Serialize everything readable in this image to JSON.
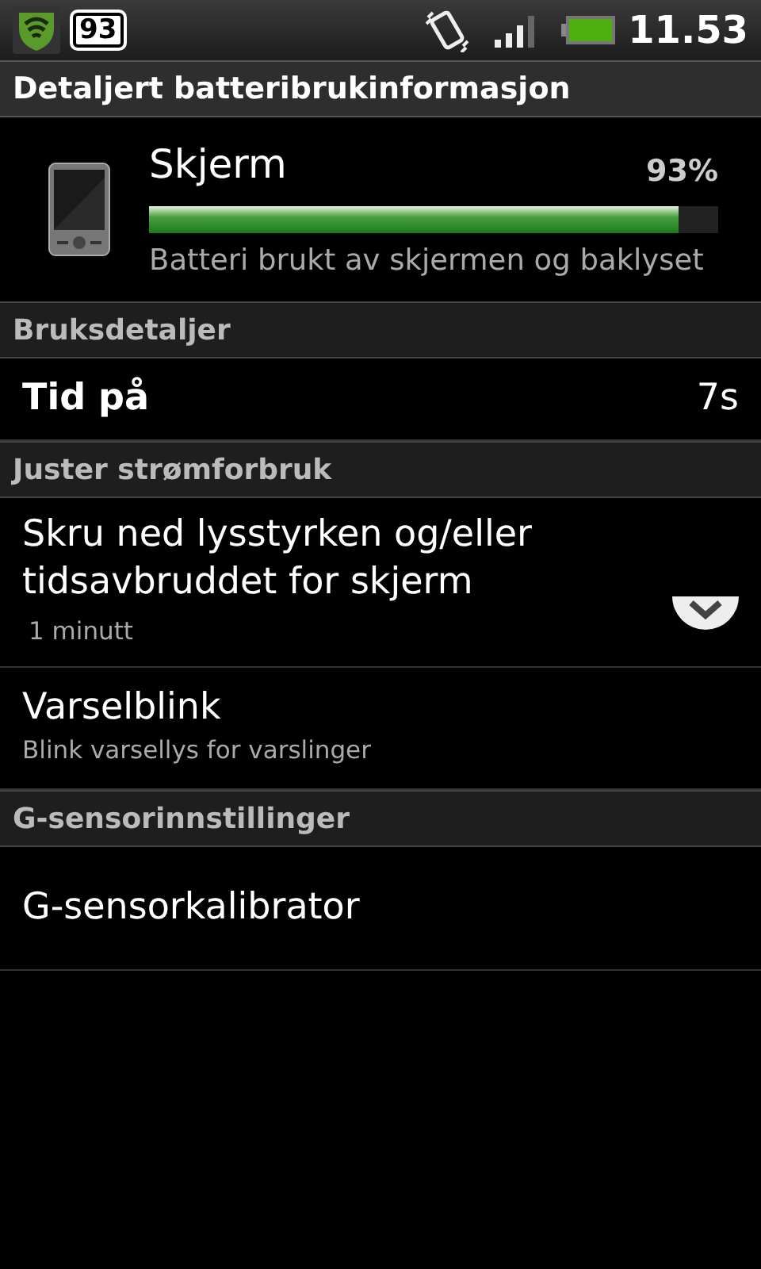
{
  "status_bar": {
    "badge": "93",
    "time": "11.53"
  },
  "title": "Detaljert batteribrukinformasjon",
  "usage": {
    "name": "Skjerm",
    "percent": "93%",
    "level": 0.93,
    "description": "Batteri brukt av skjermen og baklyset"
  },
  "sections": [
    {
      "header": "Bruksdetaljer",
      "items": [
        {
          "kind": "detail",
          "title": "Tid på",
          "value": "7s"
        }
      ]
    },
    {
      "header": "Juster strømforbruk",
      "items": [
        {
          "kind": "dropdown",
          "title": "Skru ned lysstyrken og/eller tidsavbruddet for skjerm",
          "summary": "1 minutt"
        },
        {
          "kind": "setting",
          "title": "Varselblink",
          "summary": "Blink varsellys for varslinger"
        }
      ]
    },
    {
      "header": "G-sensorinnstillinger",
      "items": [
        {
          "kind": "action",
          "title": "G-sensorkalibrator"
        }
      ]
    }
  ]
}
